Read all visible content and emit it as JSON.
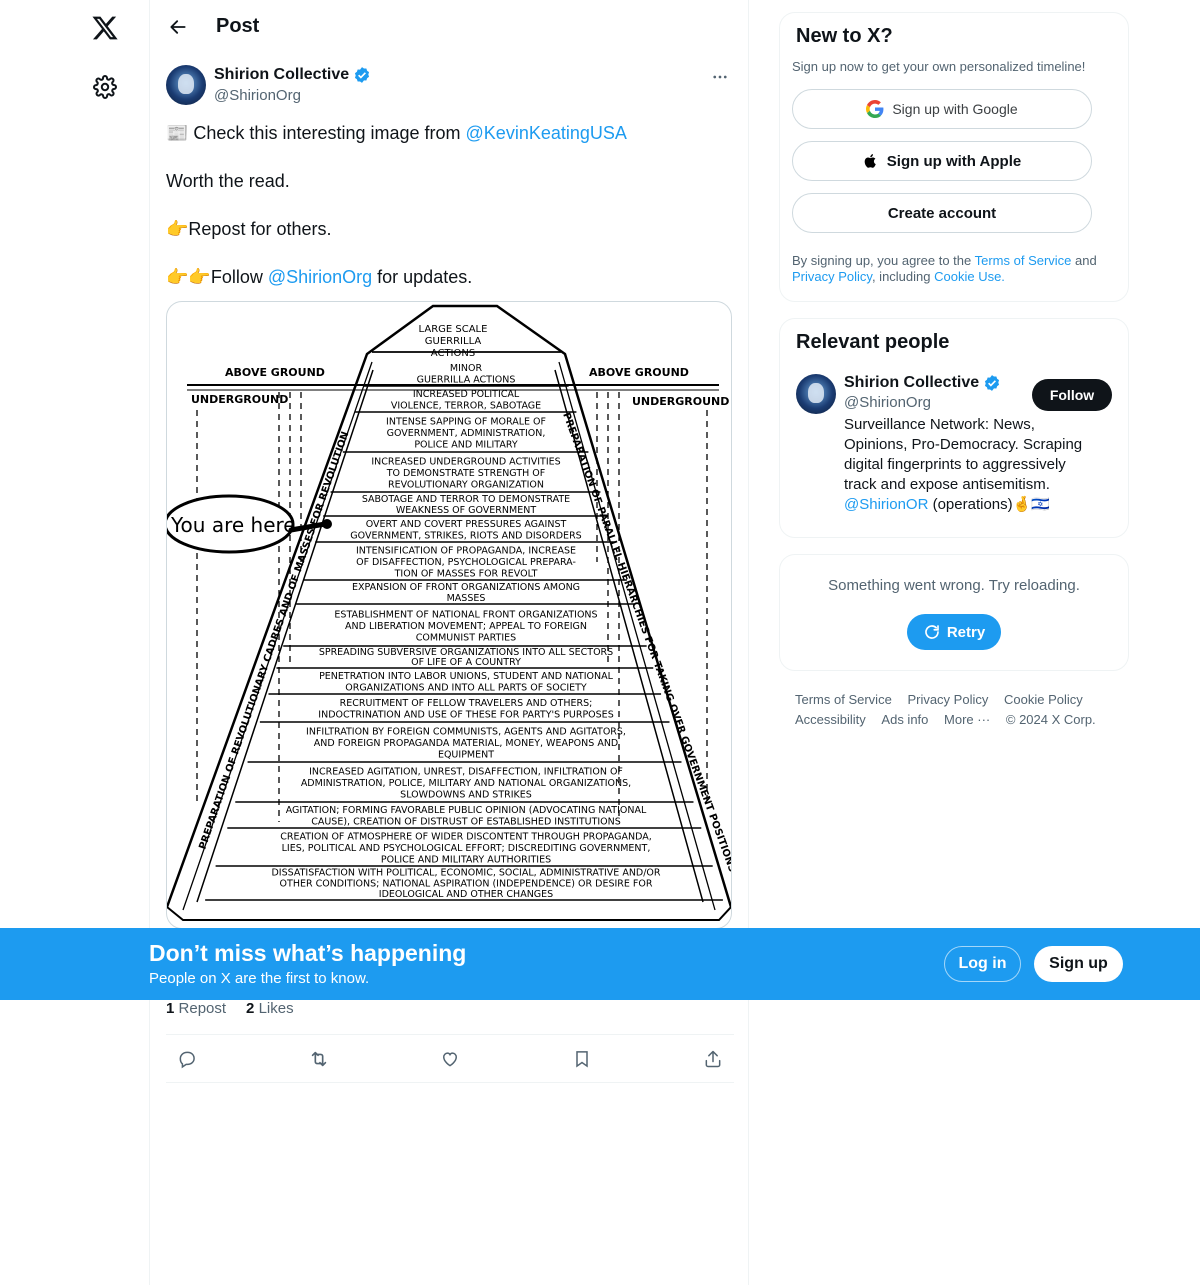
{
  "nav": {
    "logo_icon": "x-logo-icon",
    "settings_icon": "gear-icon"
  },
  "header": {
    "title": "Post"
  },
  "post": {
    "author_name": "Shirion Collective",
    "author_handle": "@ShirionOrg",
    "line1_prefix": "📰 Check this interesting image from ",
    "line1_mention": "@KevinKeatingUSA",
    "line2": "Worth the read.",
    "line3": "👉Repost for others.",
    "line4_prefix": "👉👉Follow ",
    "line4_mention": "@ShirionOrg",
    "line4_suffix": " for updates.",
    "image": {
      "above_ground_left": "ABOVE GROUND",
      "above_ground_right": "ABOVE GROUND",
      "underground_left": "UNDERGROUND",
      "underground_right": "UNDERGROUND",
      "you_are_here": "You are here",
      "left_side_text": "PREPARATION OF REVOLUTIONARY CADRES AND OF MASSES FOR REVOLUTION",
      "right_side_text": "PREPARATION OF PARALLEL HIERARCHIES FOR TAKING OVER GOVERNMENT POSITIONS",
      "top_lines": [
        "LARGE SCALE",
        "GUERRILLA",
        "ACTIONS"
      ],
      "levels": [
        [
          "MINOR",
          "GUERRILLA ACTIONS"
        ],
        [
          "INCREASED POLITICAL",
          "VIOLENCE, TERROR, SABOTAGE"
        ],
        [
          "INTENSE SAPPING OF MORALE OF",
          "GOVERNMENT, ADMINISTRATION,",
          "POLICE AND MILITARY"
        ],
        [
          "INCREASED UNDERGROUND ACTIVITIES",
          "TO DEMONSTRATE STRENGTH OF",
          "REVOLUTIONARY ORGANIZATION"
        ],
        [
          "SABOTAGE AND TERROR TO DEMONSTRATE",
          "WEAKNESS OF GOVERNMENT"
        ],
        [
          "OVERT AND COVERT PRESSURES AGAINST",
          "GOVERNMENT, STRIKES, RIOTS AND DISORDERS"
        ],
        [
          "INTENSIFICATION OF PROPAGANDA, INCREASE",
          "OF DISAFFECTION, PSYCHOLOGICAL PREPARA-",
          "TION OF MASSES FOR REVOLT"
        ],
        [
          "EXPANSION OF FRONT ORGANIZATIONS AMONG",
          "MASSES"
        ],
        [
          "ESTABLISHMENT OF NATIONAL FRONT ORGANIZATIONS",
          "AND LIBERATION MOVEMENT; APPEAL TO FOREIGN",
          "COMMUNIST PARTIES"
        ],
        [
          "SPREADING SUBVERSIVE ORGANIZATIONS INTO ALL SECTORS",
          "OF LIFE OF A COUNTRY"
        ],
        [
          "PENETRATION INTO LABOR UNIONS, STUDENT AND NATIONAL",
          "ORGANIZATIONS AND INTO ALL PARTS OF SOCIETY"
        ],
        [
          "RECRUITMENT OF FELLOW TRAVELERS AND OTHERS;",
          "INDOCTRINATION AND USE OF THESE FOR PARTY'S PURPOSES"
        ],
        [
          "INFILTRATION BY FOREIGN COMMUNISTS, AGENTS AND AGITATORS,",
          "AND FOREIGN PROPAGANDA MATERIAL, MONEY, WEAPONS AND",
          "EQUIPMENT"
        ],
        [
          "INCREASED AGITATION, UNREST, DISAFFECTION, INFILTRATION OF",
          "ADMINISTRATION, POLICE, MILITARY AND NATIONAL ORGANIZATIONS,",
          "SLOWDOWNS AND STRIKES"
        ],
        [
          "AGITATION; FORMING FAVORABLE PUBLIC OPINION (ADVOCATING NATIONAL",
          "CAUSE), CREATION OF DISTRUST OF ESTABLISHED INSTITUTIONS"
        ],
        [
          "CREATION OF ATMOSPHERE OF WIDER DISCONTENT THROUGH PROPAGANDA,",
          "LIES, POLITICAL AND PSYCHOLOGICAL EFFORT; DISCREDITING GOVERNMENT,",
          "POLICE AND MILITARY AUTHORITIES"
        ],
        [
          "DISSATISFACTION WITH POLITICAL, ECONOMIC, SOCIAL, ADMINISTRATIVE AND/OR",
          "OTHER CONDITIONS; NATIONAL ASPIRATION (INDEPENDENCE) OR DESIRE FOR",
          "IDEOLOGICAL AND OTHER CHANGES"
        ]
      ]
    },
    "repost_count": "1",
    "repost_label": "Repost",
    "like_count": "2",
    "like_label": "Likes"
  },
  "sidebar_new": {
    "title": "New to X?",
    "subtitle": "Sign up now to get your own personalized timeline!",
    "google_label": "Sign up with Google",
    "apple_label": "Sign up with Apple",
    "create_label": "Create account",
    "terms_prefix": "By signing up, you agree to the ",
    "terms_link": "Terms of Service",
    "terms_and": " and ",
    "privacy_link": "Privacy Policy",
    "terms_including": ", including ",
    "cookie_link": "Cookie Use."
  },
  "relevant_people": {
    "title": "Relevant people",
    "name": "Shirion Collective",
    "handle": "@ShirionOrg",
    "follow_label": "Follow",
    "bio": "Surveillance Network: News, Opinions, Pro-Democracy. Scraping digital fingerprints to aggressively track and expose antisemitism.",
    "bio_mention": "@ShirionOR",
    "bio_suffix": " (operations)🤞🇮🇱"
  },
  "error_card": {
    "message": "Something went wrong. Try reloading.",
    "retry_label": "Retry"
  },
  "footer": {
    "links": [
      "Terms of Service",
      "Privacy Policy",
      "Cookie Policy",
      "Accessibility",
      "Ads info",
      "More ···",
      "© 2024 X Corp."
    ]
  },
  "banner": {
    "title": "Don’t miss what’s happening",
    "subtitle": "People on X are the first to know.",
    "login_label": "Log in",
    "signup_label": "Sign up"
  },
  "colors": {
    "accent": "#1d9bf0",
    "text": "#0f1419",
    "secondary": "#536471",
    "border": "#eff3f4"
  }
}
